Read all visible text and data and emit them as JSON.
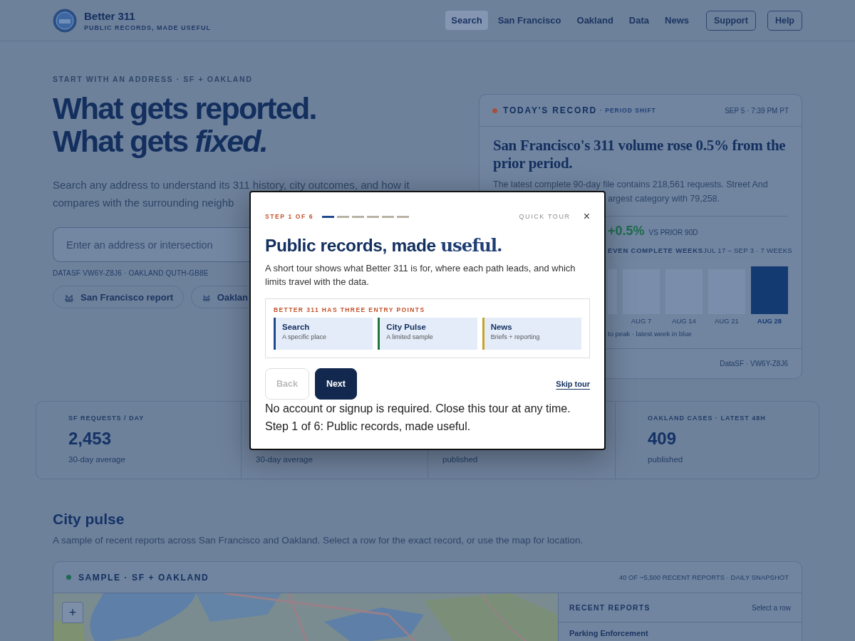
{
  "header": {
    "brand": "Better 311",
    "tagline": "PUBLIC RECORDS, MADE USEFUL",
    "nav": [
      {
        "label": "Search",
        "selected": true,
        "kind": "link"
      },
      {
        "label": "San Francisco",
        "selected": false,
        "kind": "link"
      },
      {
        "label": "Oakland",
        "selected": false,
        "kind": "link"
      },
      {
        "label": "Data",
        "selected": false,
        "kind": "link"
      },
      {
        "label": "News",
        "selected": false,
        "kind": "link"
      },
      {
        "label": "Support",
        "selected": false,
        "kind": "button"
      },
      {
        "label": "Help",
        "selected": false,
        "kind": "button"
      }
    ]
  },
  "hero": {
    "eyebrow": "START WITH AN ADDRESS · SF + OAKLAND",
    "headline": [
      "What gets reported.",
      "What gets *fixed.*"
    ],
    "intro": [
      "Search any address to understand its 311 history, city outcomes, and how it",
      "compares with the surrounding neighb"
    ],
    "search": {
      "placeholder": "Enter an address or intersection"
    },
    "sources": "DATASF VW6Y-Z8J6 · OAKLAND QUTH-GB8E",
    "chips": [
      {
        "label": "San Francisco report"
      },
      {
        "label": "Oaklan"
      }
    ]
  },
  "record_card": {
    "title": "TODAY'S RECORD",
    "subtitle": "· PERIOD SHIFT",
    "timestamp": "SEP 5 · 7:39 PM PT",
    "headline": "San Francisco's 311 volume rose 0.5% from the prior period.",
    "body": [
      "The latest complete 90-day file contains 218,561 requests. Street And",
      "argest category with 79,258."
    ],
    "change": "+0.5%",
    "change_label": "VS PRIOR 90D",
    "chart_title": "EVEN COMPLETE WEEKS",
    "chart_range": "JUL 17 – SEP 3 · 7 WEEKS",
    "weeks": [
      {
        "highlighted": false
      },
      {
        "label": "AUG 7",
        "highlighted": false
      },
      {
        "label": "AUG 14",
        "highlighted": false
      },
      {
        "label": "AUG 21",
        "highlighted": false
      },
      {
        "label": "AUG 28",
        "highlighted": true
      }
    ],
    "chart_note": "to peak · latest week in blue",
    "source": "DataSF · VW6Y-Z8J6"
  },
  "stats": [
    {
      "label": "SF REQUESTS / DAY",
      "value": "2,453",
      "note": "30-day average"
    },
    {
      "note": "30-day average"
    },
    {
      "note": "published"
    },
    {
      "label": "OAKLAND CASES · LATEST 48H",
      "value": "409",
      "note": "published"
    }
  ],
  "pulse": {
    "title": "City pulse",
    "description": "A sample of recent reports across San Francisco and Oakland. Select a row for the exact record, or use the map for location.",
    "panel_title": "SAMPLE · SF + OAKLAND",
    "panel_meta": "40 OF ~5,500 RECENT REPORTS · DAILY SNAPSHOT",
    "map": {
      "kind": "picture",
      "zoom_in": "+"
    },
    "list_title": "RECENT REPORTS",
    "list_hint": "Select a row",
    "reports": [
      {
        "title": "Parking Enforcement"
      }
    ]
  },
  "tour": {
    "step": "STEP 1 OF 6",
    "progress": [
      {
        "selected": true
      },
      {
        "selected": false
      },
      {
        "selected": false
      },
      {
        "selected": false
      },
      {
        "selected": false
      },
      {
        "selected": false
      }
    ],
    "label": "QUICK TOUR",
    "close": "×",
    "title": "Public records, made **useful.**",
    "description": "A short tour shows what Better 311 is for, where each path leads, and which limits travel with the data.",
    "entry_heading": "BETTER 311 HAS THREE ENTRY POINTS",
    "entries": [
      {
        "title": "Search",
        "subtitle": "A specific place",
        "color": "#1f4a8f"
      },
      {
        "title": "City Pulse",
        "subtitle": "A limited sample",
        "color": "#1e7a3c"
      },
      {
        "title": "News",
        "subtitle": "Briefs + reporting",
        "color": "#c9a227"
      }
    ],
    "back": {
      "label": "Back",
      "disabled": true
    },
    "next": {
      "label": "Next",
      "disabled": false
    },
    "skip": "Skip tour",
    "footer": [
      "No account or signup is required. Close this tour at any time.",
      "Step 1 of 6: Public records, made useful."
    ]
  }
}
